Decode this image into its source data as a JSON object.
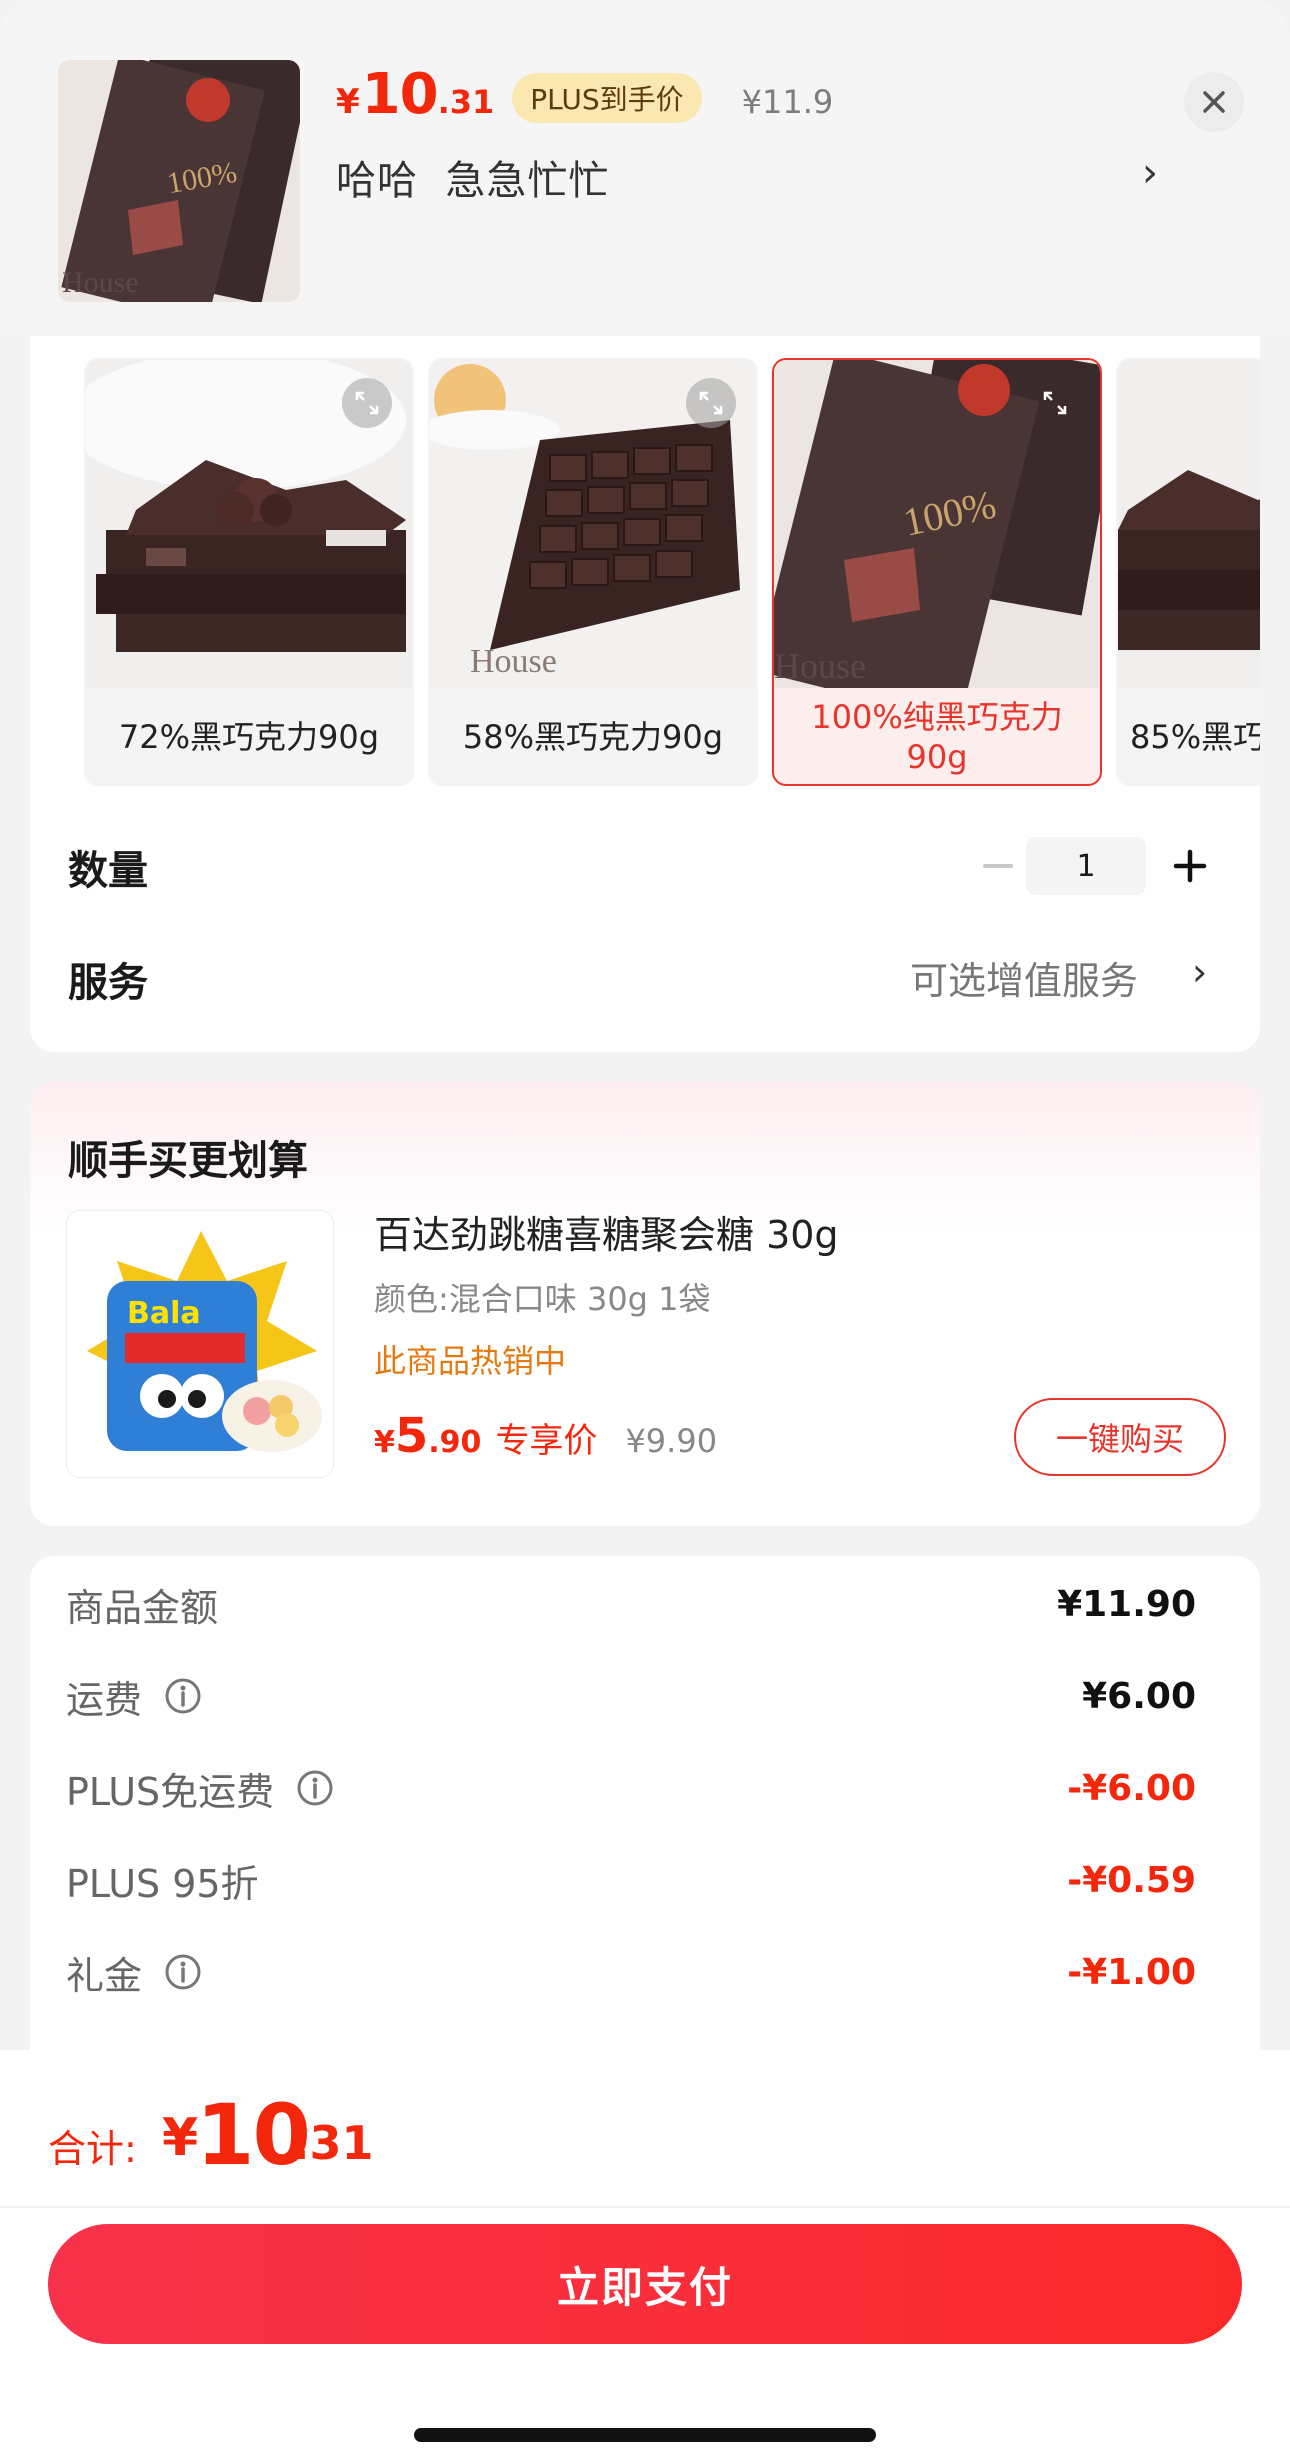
{
  "header": {
    "currency": "¥",
    "price_int": "10",
    "price_dec": ".31",
    "plus_tag": "PLUS到手价",
    "original_price": "¥11.9",
    "selected_attrs": "哈哈  急急忙忙",
    "close_icon": "close-icon"
  },
  "options": [
    {
      "label": "72%黑巧克力90g",
      "selected": false
    },
    {
      "label": "58%黑巧克力90g",
      "selected": false
    },
    {
      "label": "100%纯黑巧克力90g",
      "selected": true
    },
    {
      "label": "85%黑巧",
      "selected": false
    }
  ],
  "quantity": {
    "label": "数量",
    "value": "1"
  },
  "service": {
    "label": "服务",
    "value": "可选增值服务"
  },
  "upsell": {
    "title": "顺手买更划算",
    "name": "百达劲跳糖喜糖聚会糖 30g",
    "spec": "颜色:混合口味 30g 1袋",
    "hot": "此商品热销中",
    "currency": "¥",
    "price_int": "5",
    "price_dec": ".90",
    "exclusive": "专享价",
    "original": "¥9.90",
    "button": "一键购买"
  },
  "summary": [
    {
      "label": "商品金额",
      "value": "¥11.90",
      "info": false,
      "negative": false
    },
    {
      "label": "运费",
      "value": "¥6.00",
      "info": true,
      "negative": false
    },
    {
      "label": "PLUS免运费",
      "value": "-¥6.00",
      "info": true,
      "negative": true
    },
    {
      "label": "PLUS 95折",
      "value": "-¥0.59",
      "info": false,
      "negative": true
    },
    {
      "label": "礼金",
      "value": "-¥1.00",
      "info": true,
      "negative": true
    }
  ],
  "total": {
    "label": "合计:",
    "currency": "¥",
    "int": "10",
    "dec": ".31"
  },
  "pay_button": "立即支付",
  "colors": {
    "accent": "#f2270c",
    "plus_tag_bg": "#fbe7b0",
    "hot": "#e47a12"
  }
}
